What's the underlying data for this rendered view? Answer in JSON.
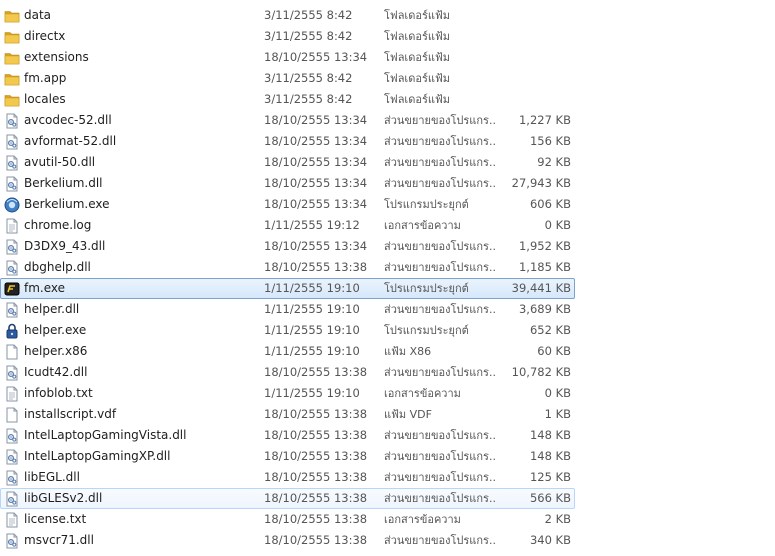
{
  "files": [
    {
      "name": "data",
      "date": "3/11/2555 8:42",
      "type": "โฟลเดอร์แฟ้ม",
      "size": "",
      "icon": "folder-icon"
    },
    {
      "name": "directx",
      "date": "3/11/2555 8:42",
      "type": "โฟลเดอร์แฟ้ม",
      "size": "",
      "icon": "folder-icon"
    },
    {
      "name": "extensions",
      "date": "18/10/2555 13:34",
      "type": "โฟลเดอร์แฟ้ม",
      "size": "",
      "icon": "folder-icon"
    },
    {
      "name": "fm.app",
      "date": "3/11/2555 8:42",
      "type": "โฟลเดอร์แฟ้ม",
      "size": "",
      "icon": "folder-icon"
    },
    {
      "name": "locales",
      "date": "3/11/2555 8:42",
      "type": "โฟลเดอร์แฟ้ม",
      "size": "",
      "icon": "folder-icon"
    },
    {
      "name": "avcodec-52.dll",
      "date": "18/10/2555 13:34",
      "type": "ส่วนขยายของโปรแกร...",
      "size": "1,227 KB",
      "icon": "dll-icon"
    },
    {
      "name": "avformat-52.dll",
      "date": "18/10/2555 13:34",
      "type": "ส่วนขยายของโปรแกร...",
      "size": "156 KB",
      "icon": "dll-icon"
    },
    {
      "name": "avutil-50.dll",
      "date": "18/10/2555 13:34",
      "type": "ส่วนขยายของโปรแกร...",
      "size": "92 KB",
      "icon": "dll-icon"
    },
    {
      "name": "Berkelium.dll",
      "date": "18/10/2555 13:34",
      "type": "ส่วนขยายของโปรแกร...",
      "size": "27,943 KB",
      "icon": "dll-icon"
    },
    {
      "name": "Berkelium.exe",
      "date": "18/10/2555 13:34",
      "type": "โปรแกรมประยุกต์",
      "size": "606 KB",
      "icon": "berkelium-exe-icon"
    },
    {
      "name": "chrome.log",
      "date": "1/11/2555 19:12",
      "type": "เอกสารข้อความ",
      "size": "0 KB",
      "icon": "text-file-icon"
    },
    {
      "name": "D3DX9_43.dll",
      "date": "18/10/2555 13:34",
      "type": "ส่วนขยายของโปรแกร...",
      "size": "1,952 KB",
      "icon": "dll-icon"
    },
    {
      "name": "dbghelp.dll",
      "date": "18/10/2555 13:38",
      "type": "ส่วนขยายของโปรแกร...",
      "size": "1,185 KB",
      "icon": "dll-icon"
    },
    {
      "name": "fm.exe",
      "date": "1/11/2555 19:10",
      "type": "โปรแกรมประยุกต์",
      "size": "39,441 KB",
      "icon": "fm-exe-icon"
    },
    {
      "name": "helper.dll",
      "date": "1/11/2555 19:10",
      "type": "ส่วนขยายของโปรแกร...",
      "size": "3,689 KB",
      "icon": "dll-icon"
    },
    {
      "name": "helper.exe",
      "date": "1/11/2555 19:10",
      "type": "โปรแกรมประยุกต์",
      "size": "652 KB",
      "icon": "lock-icon"
    },
    {
      "name": "helper.x86",
      "date": "1/11/2555 19:10",
      "type": "แฟ้ม X86",
      "size": "60 KB",
      "icon": "blank-file-icon"
    },
    {
      "name": "Icudt42.dll",
      "date": "18/10/2555 13:38",
      "type": "ส่วนขยายของโปรแกร...",
      "size": "10,782 KB",
      "icon": "dll-icon"
    },
    {
      "name": "infoblob.txt",
      "date": "1/11/2555 19:10",
      "type": "เอกสารข้อความ",
      "size": "0 KB",
      "icon": "text-file-icon"
    },
    {
      "name": "installscript.vdf",
      "date": "18/10/2555 13:38",
      "type": "แฟ้ม VDF",
      "size": "1 KB",
      "icon": "blank-file-icon"
    },
    {
      "name": "IntelLaptopGamingVista.dll",
      "date": "18/10/2555 13:38",
      "type": "ส่วนขยายของโปรแกร...",
      "size": "148 KB",
      "icon": "dll-icon"
    },
    {
      "name": "IntelLaptopGamingXP.dll",
      "date": "18/10/2555 13:38",
      "type": "ส่วนขยายของโปรแกร...",
      "size": "148 KB",
      "icon": "dll-icon"
    },
    {
      "name": "libEGL.dll",
      "date": "18/10/2555 13:38",
      "type": "ส่วนขยายของโปรแกร...",
      "size": "125 KB",
      "icon": "dll-icon"
    },
    {
      "name": "libGLESv2.dll",
      "date": "18/10/2555 13:38",
      "type": "ส่วนขยายของโปรแกร...",
      "size": "566 KB",
      "icon": "dll-icon"
    },
    {
      "name": "license.txt",
      "date": "18/10/2555 13:38",
      "type": "เอกสารข้อความ",
      "size": "2 KB",
      "icon": "text-file-icon"
    },
    {
      "name": "msvcr71.dll",
      "date": "18/10/2555 13:38",
      "type": "ส่วนขยายของโปรแกร...",
      "size": "340 KB",
      "icon": "dll-icon"
    }
  ],
  "selected_file": "fm.exe",
  "hovered_file": "libGLESv2.dll",
  "colors": {
    "folder": "#e8b62e",
    "selection_border": "#7da2ce",
    "hover_border": "#b8d6fb"
  }
}
